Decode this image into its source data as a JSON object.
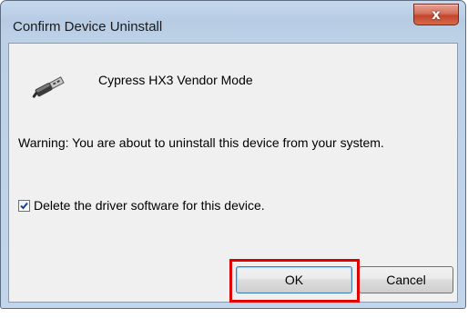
{
  "window": {
    "title": "Confirm Device Uninstall",
    "close_symbol": "x"
  },
  "device": {
    "name": "Cypress HX3 Vendor Mode",
    "icon": "usb-plug-icon"
  },
  "warning_text": "Warning: You are about to uninstall this device from your system.",
  "delete_driver": {
    "label": "Delete the driver software for this device.",
    "checked": true
  },
  "buttons": {
    "ok_label": "OK",
    "cancel_label": "Cancel"
  },
  "colors": {
    "highlight": "#e00000",
    "close_button": "#c4452c",
    "dialog_background": "#f0f0f0"
  }
}
